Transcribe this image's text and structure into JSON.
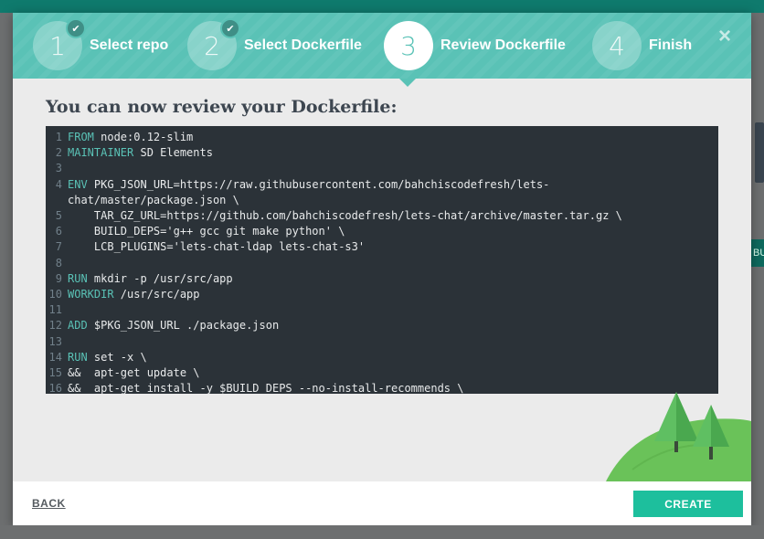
{
  "background": {
    "strip_text": "BU"
  },
  "wizard": {
    "steps": [
      {
        "number": "1",
        "label": "Select repo",
        "state": "done"
      },
      {
        "number": "2",
        "label": "Select Dockerfile",
        "state": "done"
      },
      {
        "number": "3",
        "label": "Review Dockerfile",
        "state": "active"
      },
      {
        "number": "4",
        "label": "Finish",
        "state": "pending"
      }
    ],
    "close_icon": "×",
    "check_icon": "✔"
  },
  "main": {
    "heading": "You can now review your Dockerfile:"
  },
  "dockerfile": {
    "lines": [
      {
        "num": "1",
        "kw": "FROM",
        "rest": " node:0.12-slim"
      },
      {
        "num": "2",
        "kw": "MAINTAINER",
        "rest": " SD Elements"
      },
      {
        "num": "3",
        "kw": "",
        "rest": ""
      },
      {
        "num": "4",
        "kw": "ENV",
        "rest": " PKG_JSON_URL=https://raw.githubusercontent.com/bahchiscodefresh/lets-"
      },
      {
        "num": "",
        "kw": "",
        "rest": "chat/master/package.json \\"
      },
      {
        "num": "5",
        "kw": "",
        "rest": "    TAR_GZ_URL=https://github.com/bahchiscodefresh/lets-chat/archive/master.tar.gz \\"
      },
      {
        "num": "6",
        "kw": "",
        "rest": "    BUILD_DEPS='g++ gcc git make python' \\"
      },
      {
        "num": "7",
        "kw": "",
        "rest": "    LCB_PLUGINS='lets-chat-ldap lets-chat-s3'"
      },
      {
        "num": "8",
        "kw": "",
        "rest": ""
      },
      {
        "num": "9",
        "kw": "RUN",
        "rest": " mkdir -p /usr/src/app"
      },
      {
        "num": "10",
        "kw": "WORKDIR",
        "rest": " /usr/src/app"
      },
      {
        "num": "11",
        "kw": "",
        "rest": ""
      },
      {
        "num": "12",
        "kw": "ADD",
        "rest": " $PKG_JSON_URL ./package.json"
      },
      {
        "num": "13",
        "kw": "",
        "rest": ""
      },
      {
        "num": "14",
        "kw": "RUN",
        "rest": " set -x \\"
      },
      {
        "num": "15",
        "kw": "",
        "rest": "&&  apt-get update \\"
      },
      {
        "num": "16",
        "kw": "",
        "rest": "&&  apt-get install -y $BUILD_DEPS --no-install-recommends \\"
      }
    ]
  },
  "footer": {
    "back_label": "BACK",
    "create_label": "CREATE"
  },
  "colors": {
    "header": "#5ac2b6",
    "code_bg": "#2b3238",
    "keyword": "#5ac2b6",
    "create_button": "#1dbf9d",
    "hill": "#6ac259"
  },
  "decor": {
    "illustration": "hill-with-trees"
  }
}
